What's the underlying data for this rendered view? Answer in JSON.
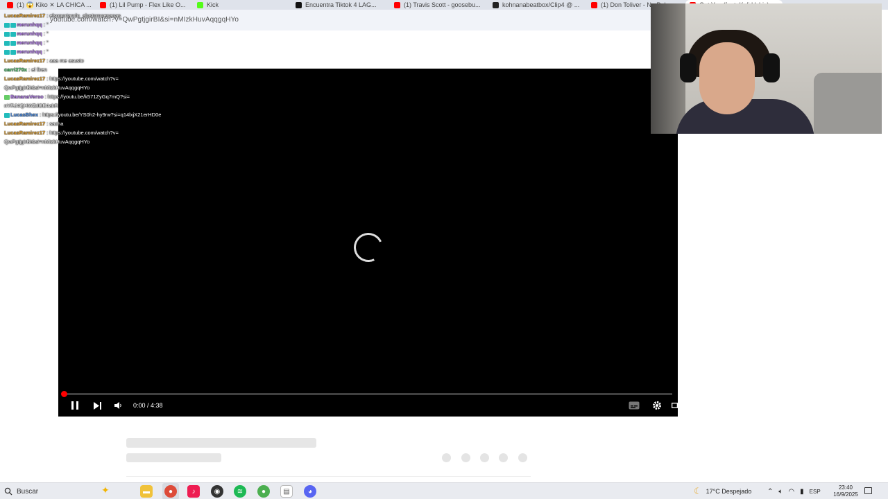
{
  "browser": {
    "tabs": [
      {
        "label": "(1) 😱 Kiko ✕ LA CHICA ...",
        "color": "#ff0000"
      },
      {
        "label": "(1) Lil Pump - Flex Like O...",
        "color": "#ff0000"
      },
      {
        "label": "Kick",
        "color": "#53fc18"
      },
      {
        "label": "Encuentra Tiktok 4 LAG...",
        "color": "#111111"
      },
      {
        "label": "(1) Travis Scott - goosebu...",
        "color": "#ff0000"
      },
      {
        "label": "kohnanabeatbox/Clip4 @ ...",
        "color": "#222222"
      },
      {
        "label": "(1) Don Toliver - No Pole...",
        "color": "#ff0000"
      },
      {
        "label": "Get You (feat. Kali Uchis)",
        "color": "#ff0000"
      }
    ],
    "url": "youtube.com/watch?v=QwPgtjgirBI&si=nMIzkHuvAqqgqHYo"
  },
  "chat": {
    "messages": [
      {
        "user": "LucasRamirez17",
        "color": "#e0a030",
        "text": "elsoportando_alostomoenanas",
        "badges": 0
      },
      {
        "user": "merunhqq",
        "color": "#b07ce6",
        "text": "\"",
        "badges": 2
      },
      {
        "user": "merunhqq",
        "color": "#b07ce6",
        "text": "\"",
        "badges": 2
      },
      {
        "user": "merunhqq",
        "color": "#b07ce6",
        "text": "\"",
        "badges": 2
      },
      {
        "user": "merunhqq",
        "color": "#b07ce6",
        "text": "\"",
        "badges": 2
      },
      {
        "user": "LucasRamirez17",
        "color": "#e0a030",
        "text": "aaa me asusto",
        "badges": 0
      },
      {
        "user": "carri270x",
        "color": "#4fc36b",
        "text": "el firen",
        "badges": 0
      },
      {
        "user": "LucasRamirez17",
        "color": "#e0a030",
        "text": "https://youtube.com/watch?v=QwPgtjgirBI&si=nMIzkHuvAqqgqHYo",
        "badges": 0
      },
      {
        "user": "BananaVerso",
        "color": "#b07ce6",
        "text": "https://youtu.be/k571ZyGq7mQ?si=nYRJ4QHWZdOE4akR",
        "badges": 1
      },
      {
        "user": "LucasBhex",
        "color": "#4d8fe6",
        "text": "https://youtu.be/YS0h2-hy9rw?si=q14lxjX21erHD0e",
        "badges": 1
      },
      {
        "user": "LucasRamirez17",
        "color": "#e0a030",
        "text": "sacha",
        "badges": 0
      },
      {
        "user": "LucasRamirez17",
        "color": "#e0a030",
        "text": "https://youtube.com/watch?v=QwPgtjgirBI&si=nMIzkHuvAqqgqHYo",
        "badges": 0
      }
    ]
  },
  "player": {
    "time": "0:00 / 4:38",
    "progress_fraction": 0.0,
    "icons": [
      "pause-icon",
      "next-icon",
      "volume-icon",
      "subtitles-icon",
      "settings-icon",
      "fullscreen-icon"
    ]
  },
  "taskbar": {
    "search_label": "Buscar",
    "weather": "17°C  Despejado",
    "language": "ESP",
    "time": "23:40",
    "date": "16/9/2025"
  }
}
